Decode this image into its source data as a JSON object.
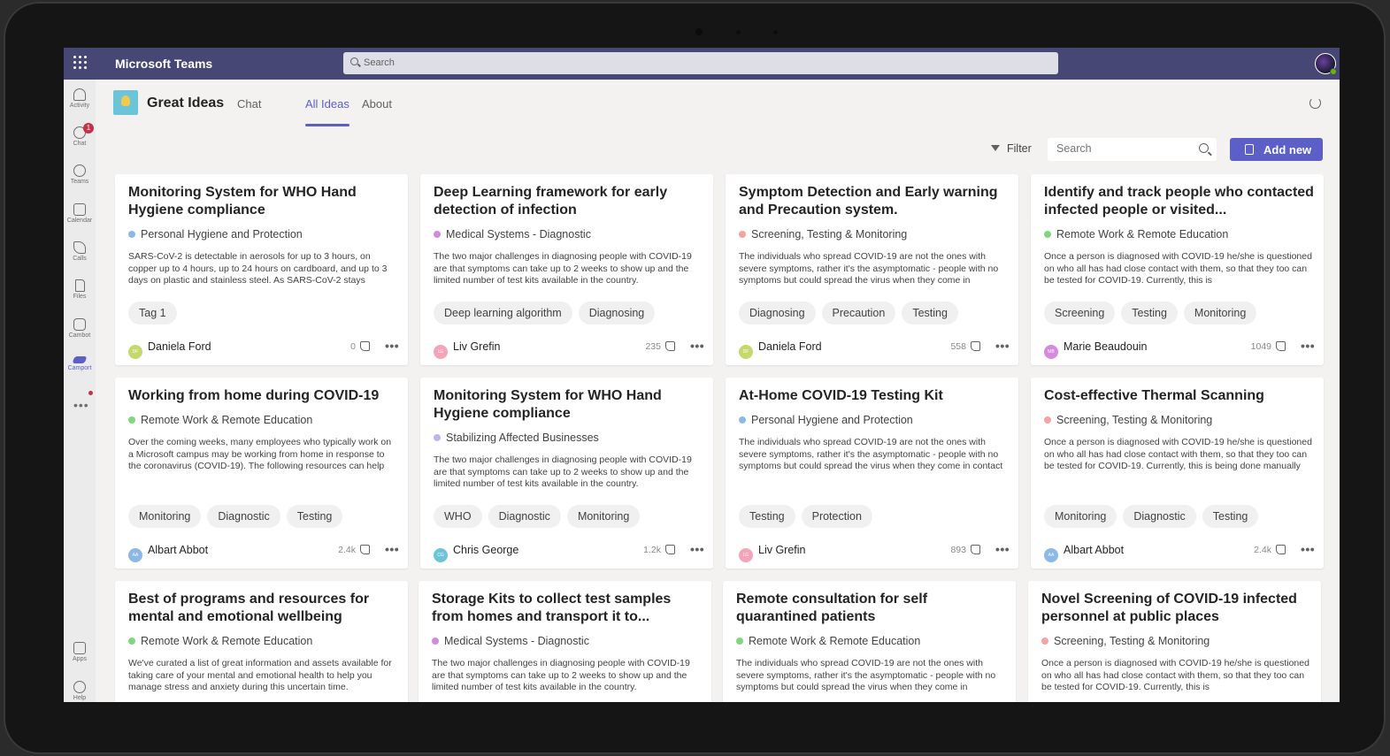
{
  "app": {
    "title": "Microsoft Teams",
    "search_placeholder": "Search"
  },
  "rail": {
    "items": [
      {
        "label": "Activity",
        "icon": "bell-icon"
      },
      {
        "label": "Chat",
        "icon": "chat-icon",
        "badge": "1"
      },
      {
        "label": "Teams",
        "icon": "teams-icon"
      },
      {
        "label": "Calendar",
        "icon": "calendar-icon"
      },
      {
        "label": "Calls",
        "icon": "phone-icon"
      },
      {
        "label": "Files",
        "icon": "file-icon"
      },
      {
        "label": "Cambot",
        "icon": "bot-icon"
      },
      {
        "label": "Camport",
        "icon": "camport-icon"
      }
    ],
    "more": "•••",
    "bottom": [
      {
        "label": "Apps",
        "icon": "apps-icon"
      },
      {
        "label": "Help",
        "icon": "help-icon"
      }
    ]
  },
  "header": {
    "title": "Great Ideas",
    "tabs": [
      {
        "label": "Chat"
      },
      {
        "label": "All Ideas",
        "active": true
      },
      {
        "label": "About"
      }
    ]
  },
  "toolbar": {
    "filter_label": "Filter",
    "search_placeholder": "Search",
    "add_label": "Add new"
  },
  "colors": {
    "accent": "#5b5fc7",
    "topbar": "#464775",
    "blue_dot": "#8cb8e8",
    "purple_dot": "#d58ae0",
    "salmon_dot": "#f4a3a0",
    "green_dot": "#7fd67f",
    "lavender_dot": "#b9b7f2"
  },
  "cards": [
    {
      "title": "Monitoring System for WHO Hand Hygiene compliance",
      "category": "Personal Hygiene and Protection",
      "dot": "#8cb8e8",
      "desc": "SARS-CoV-2 is detectable in aerosols for up to 3 hours, on copper up to 4 hours, up to 24 hours on cardboard, and up to 3 days on plastic and stainless steel. As SARS-CoV-2 stays",
      "tags": [
        "Tag 1"
      ],
      "author": "Daniela Ford",
      "initials": "DF",
      "avatar": "#c5d96b",
      "likes": "0"
    },
    {
      "title": "Deep Learning framework for early detection of infection",
      "category": "Medical Systems - Diagnostic",
      "dot": "#d58ae0",
      "desc": "The two major challenges in diagnosing people with COVID-19 are that symptoms can take up to 2 weeks to show up and the limited number of test kits available in the country.",
      "tags": [
        "Deep learning algorithm",
        "Diagnosing"
      ],
      "author": "Liv Grefin",
      "initials": "LG",
      "avatar": "#f4a3b8",
      "likes": "235"
    },
    {
      "title": "Symptom Detection and Early warning and Precaution system.",
      "category": "Screening, Testing & Monitoring",
      "dot": "#f4a3a0",
      "desc": "The individuals who spread COVID-19 are not the ones with severe symptoms, rather it's the asymptomatic - people with no symptoms but could spread the virus when they come in",
      "tags": [
        "Diagnosing",
        "Precaution",
        "Testing"
      ],
      "author": "Daniela Ford",
      "initials": "DF",
      "avatar": "#c5d96b",
      "likes": "558"
    },
    {
      "title": "Identify and track people who contacted infected people or visited...",
      "category": "Remote Work & Remote Education",
      "dot": "#7fd67f",
      "desc": "Once a person is diagnosed with COVID-19 he/she is questioned on who all has had close contact with them, so that they too can be tested for COVID-19. Currently, this is",
      "tags": [
        "Screening",
        "Testing",
        "Monitoring"
      ],
      "author": "Marie Beaudouin",
      "initials": "MB",
      "avatar": "#d58ae0",
      "likes": "1049"
    },
    {
      "title": "Working from home during COVID-19",
      "category": "Remote Work & Remote Education",
      "dot": "#7fd67f",
      "desc": "Over the coming weeks, many employees who typically work on a Microsoft campus may be working from home in response to the coronavirus (COVID-19). The following resources can help you stay connected and productive while",
      "tags": [
        "Monitoring",
        "Diagnostic",
        "Testing"
      ],
      "author": "Albart Abbot",
      "initials": "AA",
      "avatar": "#8cb8e8",
      "likes": "2.4k"
    },
    {
      "title": "Monitoring System for WHO Hand Hygiene compliance",
      "category": "Stabilizing Affected Businesses",
      "dot": "#b9b7f2",
      "desc": "The two major challenges in diagnosing people with COVID-19 are that symptoms can take up to 2 weeks to show up and the limited number of test kits available in the country.",
      "tags": [
        "WHO",
        "Diagnostic",
        "Monitoring"
      ],
      "author": "Chris George",
      "initials": "CG",
      "avatar": "#6cc4d9",
      "likes": "1.2k"
    },
    {
      "title": "At-Home COVID-19 Testing Kit",
      "category": "Personal Hygiene and Protection",
      "dot": "#8cb8e8",
      "desc": "The individuals who spread COVID-19 are not the ones with severe symptoms, rather it's the asymptomatic - people with no symptoms but could spread the virus when they come in contact with others.",
      "tags": [
        "Testing",
        "Protection"
      ],
      "author": "Liv Grefin",
      "initials": "LG",
      "avatar": "#f4a3b8",
      "likes": "893"
    },
    {
      "title": "Cost-effective Thermal Scanning",
      "category": "Screening, Testing & Monitoring",
      "dot": "#f4a3a0",
      "desc": "Once a person is diagnosed with COVID-19 he/she is questioned on who all has had close contact with them, so that they too can be tested for COVID-19. Currently, this is being done manually and is prone to errors.",
      "tags": [
        "Monitoring",
        "Diagnostic",
        "Testing"
      ],
      "author": "Albart Abbot",
      "initials": "AA",
      "avatar": "#8cb8e8",
      "likes": "2.4k"
    },
    {
      "title": "Best of programs and resources for mental and emotional wellbeing",
      "category": "Remote Work & Remote Education",
      "dot": "#7fd67f",
      "desc": "We've curated a list of great information and assets available for taking care of your mental and emotional health to help you manage stress and anxiety during this uncertain time.",
      "tags": [],
      "author": "",
      "initials": "",
      "avatar": "",
      "likes": ""
    },
    {
      "title": "Storage Kits to collect test samples from homes and transport it to...",
      "category": "Medical Systems - Diagnostic",
      "dot": "#d58ae0",
      "desc": "The two major challenges in diagnosing people with COVID-19 are that symptoms can take up to 2 weeks to show up and the limited number of test kits available in the country.",
      "tags": [],
      "author": "",
      "initials": "",
      "avatar": "",
      "likes": ""
    },
    {
      "title": "Remote consultation for self quarantined patients",
      "category": "Remote Work & Remote Education",
      "dot": "#7fd67f",
      "desc": "The individuals who spread COVID-19 are not the ones with severe symptoms, rather it's the asymptomatic - people with no symptoms but could spread the virus when they come in",
      "tags": [],
      "author": "",
      "initials": "",
      "avatar": "",
      "likes": ""
    },
    {
      "title": "Novel Screening of COVID-19 infected personnel at public places",
      "category": "Screening, Testing & Monitoring",
      "dot": "#f4a3a0",
      "desc": "Once a person is diagnosed with COVID-19 he/she is questioned on who all has had close contact with them, so that they too can be tested for COVID-19. Currently, this is",
      "tags": [],
      "author": "",
      "initials": "",
      "avatar": "",
      "likes": ""
    }
  ]
}
